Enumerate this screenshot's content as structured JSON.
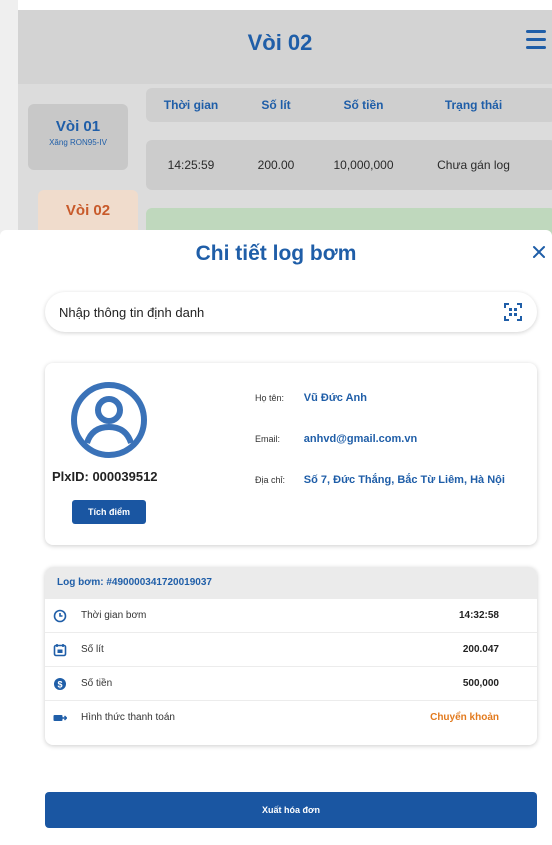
{
  "background": {
    "title": "Vòi 02",
    "nozzles": [
      {
        "name": "Vòi 01",
        "fuel": "Xăng RON95-IV"
      },
      {
        "name": "Vòi 02",
        "fuel": ""
      }
    ],
    "table": {
      "headers": [
        "Thời gian",
        "Số lít",
        "Số tiền",
        "Trạng thái"
      ],
      "rows": [
        [
          "14:25:59",
          "200.00",
          "10,000,000",
          "Chưa gán log"
        ]
      ]
    }
  },
  "sheet": {
    "title": "Chi tiết log bơm",
    "id_input": {
      "value": "Nhập thông tin định danh"
    },
    "user": {
      "plxid": "PlxID: 000039512",
      "points_button": "Tích điểm",
      "name_label": "Họ tên:",
      "name": "Vũ Đức Anh",
      "email_label": "Email:",
      "email": "anhvd@gmail.com.vn",
      "address_label": "Địa chỉ:",
      "address": "Số 7, Đức Thắng, Bắc Từ Liêm, Hà Nội"
    },
    "log": {
      "header": "Log bơm: #490000341720019037",
      "rows": [
        {
          "icon": "clock-icon",
          "label": "Thời gian bơm",
          "value": "14:32:58"
        },
        {
          "icon": "calendar-icon",
          "label": "Số lít",
          "value": "200.047"
        },
        {
          "icon": "dollar-icon",
          "label": "Số tiền",
          "value": "500,000"
        },
        {
          "icon": "payment-card-icon",
          "label": "Hình thức thanh toán",
          "value": "Chuyển khoản"
        }
      ]
    },
    "invoice_button": "Xuất hóa đơn"
  },
  "colors": {
    "primary": "#1f5ea8",
    "button": "#1a56a2",
    "accent_orange": "#e27a1e"
  }
}
